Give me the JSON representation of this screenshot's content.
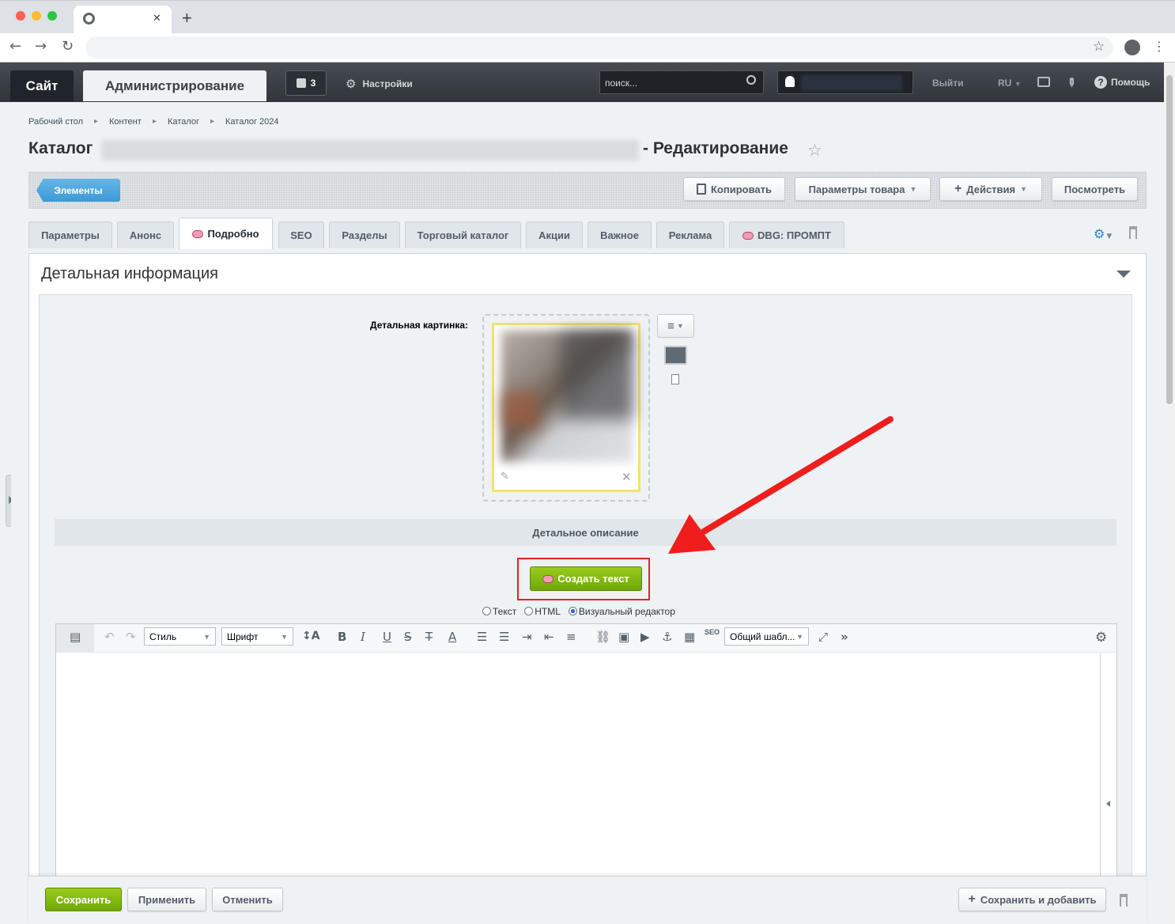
{
  "browser": {
    "new_tab_symbol": "+",
    "close_symbol": "✕"
  },
  "adminbar": {
    "site_tab": "Сайт",
    "admin_tab": "Администрирование",
    "notifications_count": "3",
    "settings_label": "Настройки",
    "search_placeholder": "поиск...",
    "logout_label": "Выйти",
    "language": "RU",
    "help_label": "Помощь"
  },
  "breadcrumb": [
    "Рабочий стол",
    "Контент",
    "Каталог",
    "Каталог 2024"
  ],
  "page": {
    "title_prefix": "Каталог",
    "title_suffix": "- Редактирование"
  },
  "toolbar": {
    "elements_label": "Элементы",
    "copy_label": "Копировать",
    "params_label": "Параметры товара",
    "actions_label": "Действия",
    "view_label": "Посмотреть"
  },
  "tabs": [
    "Параметры",
    "Анонс",
    "Подробно",
    "SEO",
    "Разделы",
    "Торговый каталог",
    "Акции",
    "Важное",
    "Реклама",
    "DBG: ПРОМПТ"
  ],
  "section": {
    "title": "Детальная информация",
    "picture_label": "Детальная картинка:",
    "description_title": "Детальное описание",
    "create_text_label": "Создать текст",
    "modes": [
      "Текст",
      "HTML",
      "Визуальный редактор"
    ],
    "selected_mode": "Визуальный редактор"
  },
  "editor": {
    "style_select": "Стиль",
    "font_select": "Шрифт",
    "template_select": "Общий шабл...",
    "seo_badge": "SEO"
  },
  "footer": {
    "save_label": "Сохранить",
    "apply_label": "Применить",
    "cancel_label": "Отменить",
    "save_add_label": "Сохранить и добавить"
  },
  "colors": {
    "accent_green": "#7ab80e",
    "accent_blue": "#3d9ad4",
    "annotation_red": "#e02424"
  }
}
